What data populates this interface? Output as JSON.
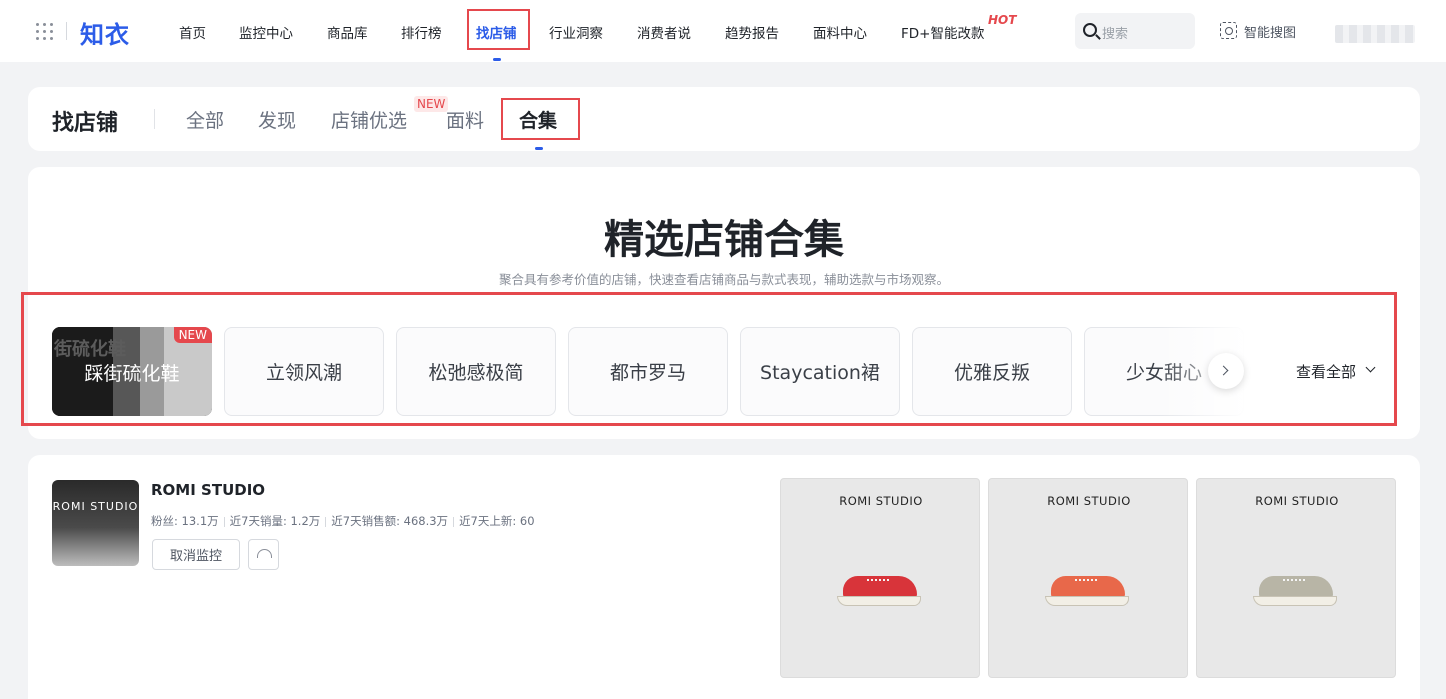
{
  "topnav": {
    "logo": "知衣",
    "items": [
      {
        "label": "首页"
      },
      {
        "label": "监控中心"
      },
      {
        "label": "商品库"
      },
      {
        "label": "排行榜"
      },
      {
        "label": "找店铺"
      },
      {
        "label": "行业洞察"
      },
      {
        "label": "消费者说"
      },
      {
        "label": "趋势报告"
      },
      {
        "label": "面料中心"
      },
      {
        "label": "FD+智能改款"
      }
    ],
    "active_item": "找店铺",
    "hot_badge": "HOT",
    "search_placeholder": "搜索",
    "image_search_label": "智能搜图"
  },
  "subnav": {
    "title": "找店铺",
    "tabs": [
      {
        "label": "全部"
      },
      {
        "label": "发现"
      },
      {
        "label": "店铺优选"
      },
      {
        "label": "面料"
      },
      {
        "label": "合集"
      }
    ],
    "active_tab": "合集",
    "new_badge": "NEW"
  },
  "hero": {
    "title": "精选店铺合集",
    "subtitle": "聚合具有参考价值的店铺，快速查看店铺商品与款式表现，辅助选款与市场观察。",
    "featured": {
      "label": "踩街硫化鞋",
      "badge": "NEW",
      "bg_text": "街硫化鞋"
    },
    "chips": [
      {
        "label": "立领风潮"
      },
      {
        "label": "松弛感极简"
      },
      {
        "label": "都市罗马"
      },
      {
        "label": "Staycation裙"
      },
      {
        "label": "优雅反叛"
      },
      {
        "label": "少女甜心"
      }
    ],
    "view_all": "查看全部"
  },
  "shop": {
    "logo_text": "ROMI STUDIO",
    "name": "ROMI STUDIO",
    "stats": [
      {
        "label": "粉丝: 13.1万"
      },
      {
        "label": "近7天销量: 1.2万"
      },
      {
        "label": "近7天销售额: 468.3万"
      },
      {
        "label": "近7天上新: 60"
      }
    ],
    "monitor_button": "取消监控",
    "products": [
      {
        "brand": "ROMI STUDIO",
        "color": "#d8343a"
      },
      {
        "brand": "ROMI STUDIO",
        "color": "#e8684a"
      },
      {
        "brand": "ROMI STUDIO",
        "color": "#b8b5a6"
      }
    ]
  },
  "colors": {
    "accent": "#2c5ce8",
    "highlight": "#e5484d"
  }
}
